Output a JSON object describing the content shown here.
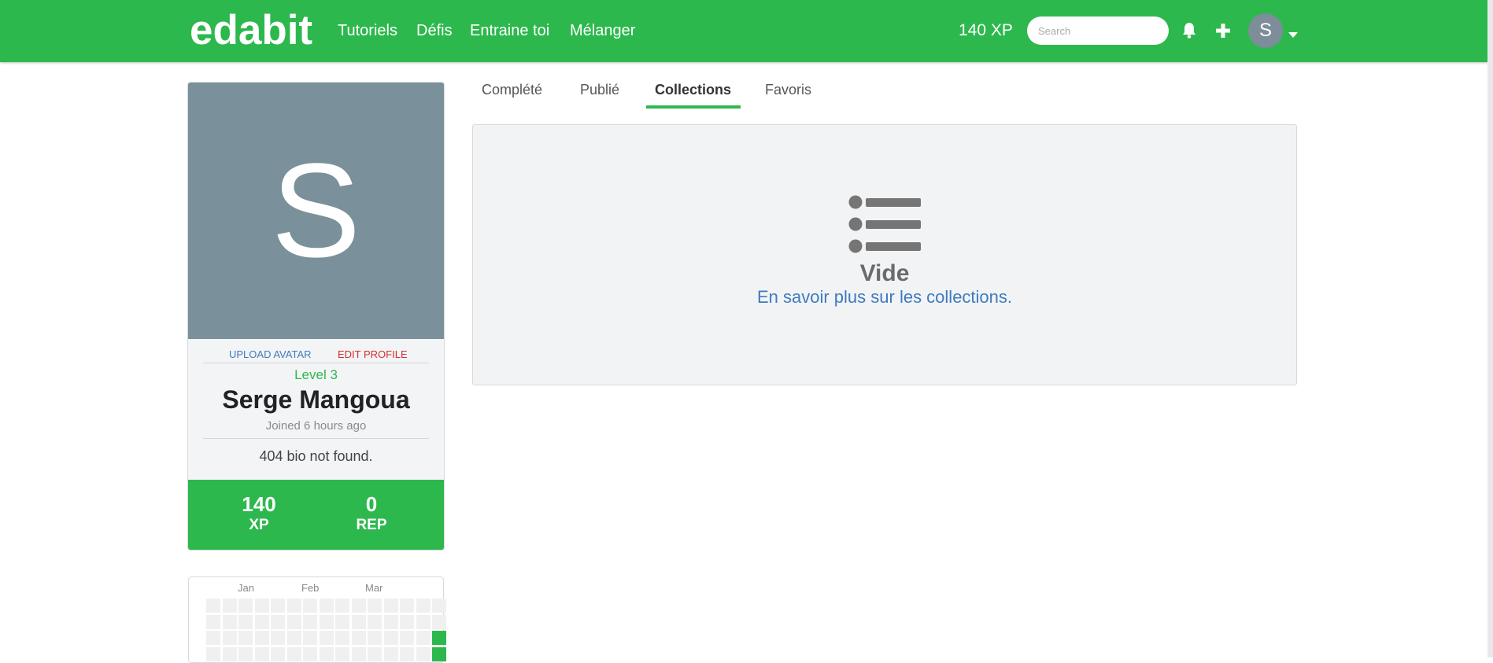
{
  "navbar": {
    "logo": "edabit",
    "links": [
      "Tutoriels",
      "Défis",
      "Entraine toi",
      "Mélanger"
    ],
    "xp": "140 XP",
    "search_placeholder": "Search",
    "avatar_letter": "S",
    "bell_icon": "bell-icon",
    "plus_icon": "plus-icon",
    "caret_icon": "caret-down-icon",
    "brand_color": "#2db84d"
  },
  "profile": {
    "avatar_letter": "S",
    "upload_avatar": "UPLOAD AVATAR",
    "edit_profile": "EDIT PROFILE",
    "level": "Level 3",
    "name": "Serge Mangoua",
    "joined": "Joined 6 hours ago",
    "bio": "404 bio not found.",
    "stats": [
      {
        "value": "140",
        "label": "XP"
      },
      {
        "value": "0",
        "label": "REP"
      }
    ]
  },
  "heatmap": {
    "months": [
      "Jan",
      "Feb",
      "Mar"
    ]
  },
  "tabs": [
    {
      "label": "Complété",
      "active": false
    },
    {
      "label": "Publié",
      "active": false
    },
    {
      "label": "Collections",
      "active": true
    },
    {
      "label": "Favoris",
      "active": false
    }
  ],
  "empty_state": {
    "icon": "list-icon",
    "title": "Vide",
    "link": "En savoir plus sur les collections."
  }
}
